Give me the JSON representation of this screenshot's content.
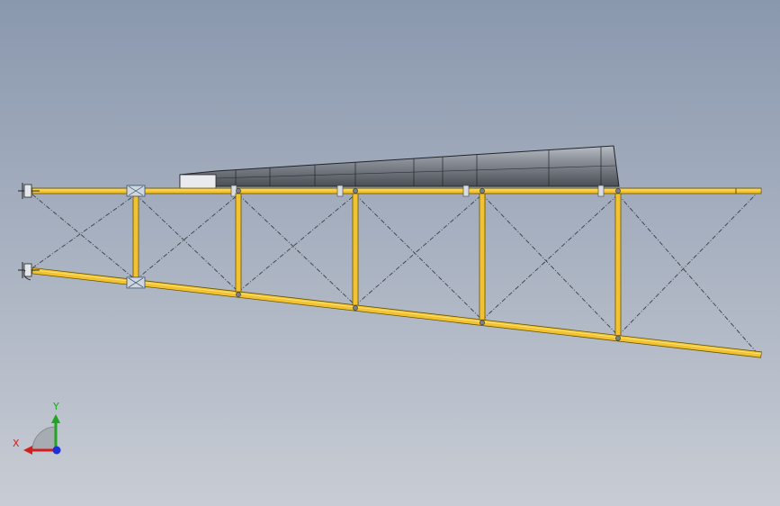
{
  "viewport": {
    "background_top": "#8a98ae",
    "background_bottom": "#c8ccd4"
  },
  "colors": {
    "member_fill": "#f2c230",
    "member_stroke": "#6a5400",
    "member_highlight": "#fae47a",
    "brace": "#3a3f46",
    "hopper_light": "#b9bec6",
    "hopper_dark": "#4a4e55",
    "hopper_edge": "#222428",
    "node": "#7a8088"
  },
  "triad": {
    "x_label": "X",
    "y_label": "Y",
    "x_color": "#d41e1e",
    "y_color": "#1fa51f",
    "z_color": "#1e2fd4"
  }
}
